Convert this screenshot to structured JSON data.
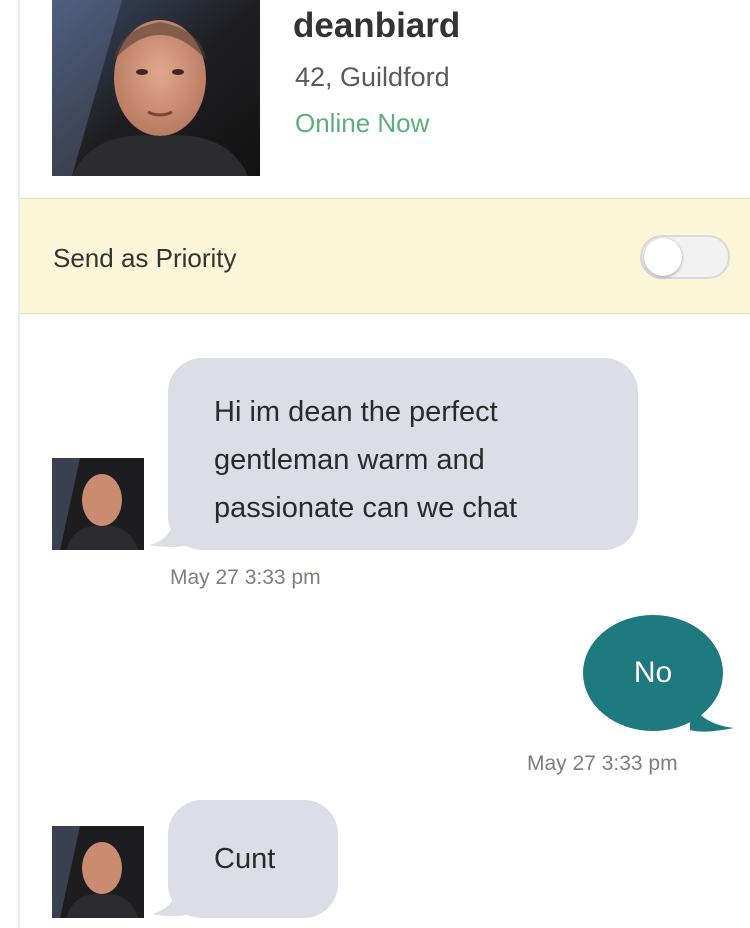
{
  "profile": {
    "username": "deanbiard",
    "age_location": "42, Guildford",
    "status": "Online Now",
    "status_color": "#5cae7c",
    "avatar_icon": "profile-photo"
  },
  "priority": {
    "label": "Send as Priority",
    "toggle_on": false
  },
  "messages": [
    {
      "from": "them",
      "text": "Hi im dean the perfect gentleman warm and passionate can we chat",
      "time": "May 27 3:33 pm"
    },
    {
      "from": "me",
      "text": "No",
      "time": "May 27 3:33 pm"
    },
    {
      "from": "them",
      "text": "Cunt",
      "time": ""
    }
  ],
  "colors": {
    "incoming_bubble": "#dcdde6",
    "outgoing_bubble": "#1f7a80",
    "priority_bar": "#fbf6d8"
  }
}
